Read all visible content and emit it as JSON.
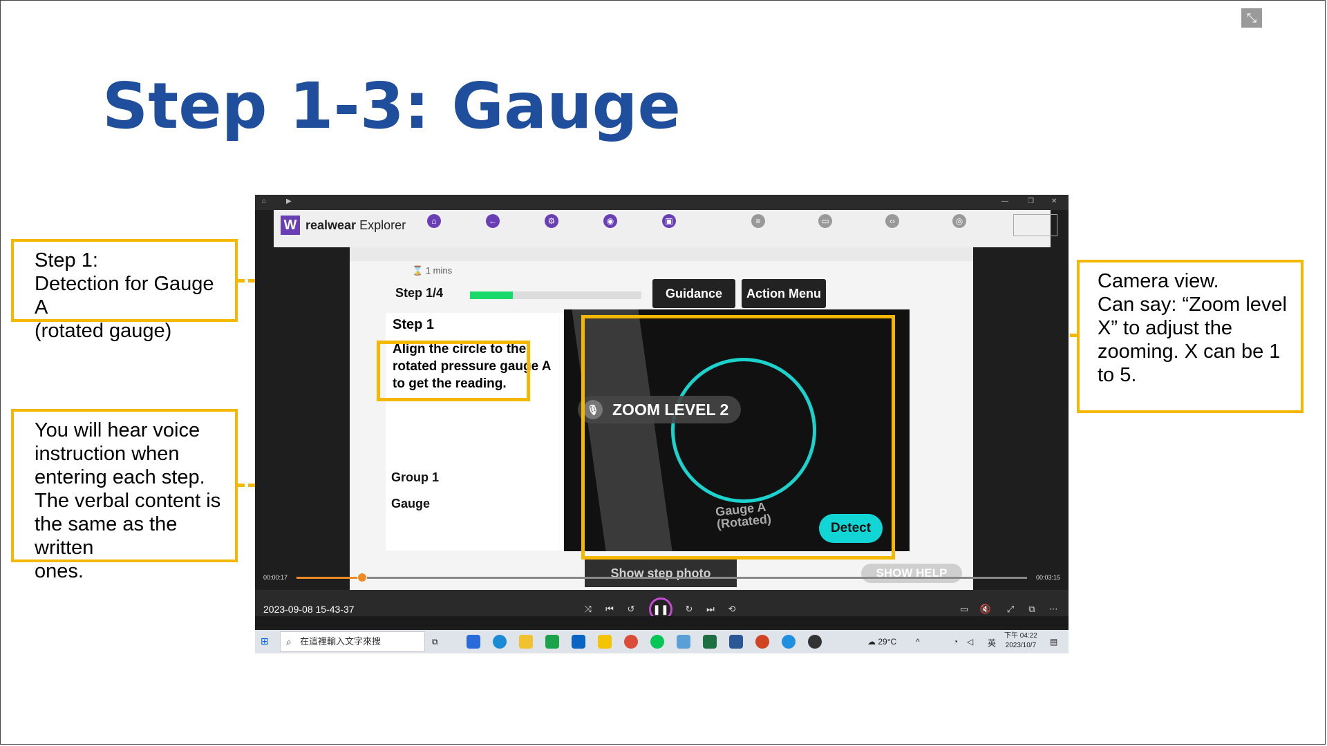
{
  "slide": {
    "title": "Step 1-3: Gauge",
    "exit_fullscreen_icon": "compress-icon"
  },
  "callouts": {
    "step1": "Step 1:\nDetection for Gauge A\n(rotated gauge)",
    "voice": "You will hear voice\ninstruction when\nentering each step.\nThe verbal content is\nthe same as the written\nones.",
    "camera": "Camera view.\nCan say: “Zoom level\nX” to adjust the\nzooming. X can be 1\nto 5."
  },
  "colors": {
    "title": "#1f4e9c",
    "callout_border": "#f5b800",
    "progress": "#18d96a",
    "detect": "#12d6d6",
    "ring": "#1bd2cc",
    "timeline": "#f08a24"
  },
  "app": {
    "brand": "realwear",
    "brand_suffix": "Explorer",
    "mins": "1 mins",
    "step_count": "Step 1/4",
    "progress_fraction": 0.25,
    "guidance_label": "Guidance",
    "action_menu_label": "Action Menu",
    "step_title": "Step 1",
    "step_desc": "Align the circle to the rotated pressure gauge A to get the reading.",
    "group": "Group 1",
    "gauge": "Gauge",
    "zoom_text": "ZOOM LEVEL 2",
    "cam_text": "Gauge A\n(Rotated)",
    "detect_label": "Detect",
    "show_step_photo": "Show step photo",
    "show_help": "SHOW HELP"
  },
  "player": {
    "time_current": "00:00:17",
    "time_total": "00:03:15",
    "position_fraction": 0.09,
    "date_label": "2023-09-08 15-43-37"
  },
  "taskbar": {
    "search_placeholder": "在這裡輸入文字來搜",
    "temperature": "29°C",
    "ime": "英",
    "time": "下午 04:22",
    "date": "2023/10/7"
  }
}
